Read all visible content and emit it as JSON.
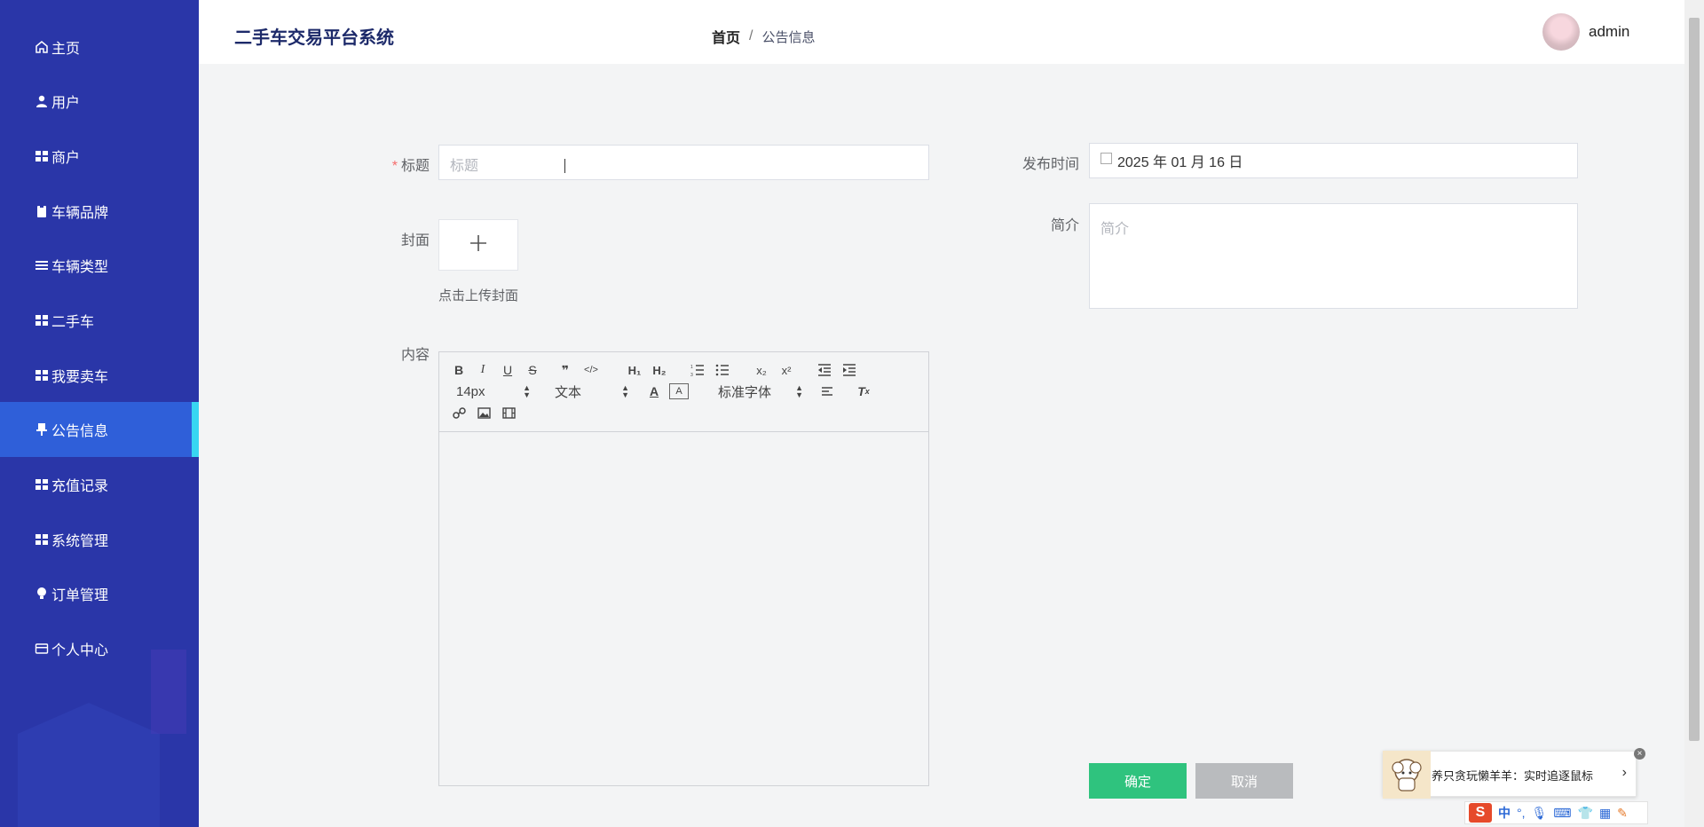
{
  "app": {
    "title": "二手车交易平台系统",
    "user": "admin"
  },
  "breadcrumb": {
    "home": "首页",
    "sep": "/",
    "current": "公告信息"
  },
  "menu": [
    {
      "label": "主页",
      "icon": "home-icon"
    },
    {
      "label": "用户",
      "icon": "user-icon"
    },
    {
      "label": "商户",
      "icon": "grid-icon"
    },
    {
      "label": "车辆品牌",
      "icon": "clipboard-icon"
    },
    {
      "label": "车辆类型",
      "icon": "list-icon"
    },
    {
      "label": "二手车",
      "icon": "grid-icon"
    },
    {
      "label": "我要卖车",
      "icon": "grid-icon"
    },
    {
      "label": "公告信息",
      "icon": "pin-icon",
      "active": true
    },
    {
      "label": "充值记录",
      "icon": "grid-icon"
    },
    {
      "label": "系统管理",
      "icon": "grid-icon"
    },
    {
      "label": "订单管理",
      "icon": "bulb-icon"
    },
    {
      "label": "个人中心",
      "icon": "card-icon"
    }
  ],
  "form": {
    "title_label": "标题",
    "title_placeholder": "标题",
    "date_label": "发布时间",
    "date_value": "2025 年 01 月 16 日",
    "cover_label": "封面",
    "upload_tip": "点击上传封面",
    "intro_label": "简介",
    "intro_placeholder": "简介",
    "content_label": "内容",
    "editor": {
      "font_size": "14px",
      "block": "文本",
      "font_family": "标准字体"
    },
    "submit": "确定",
    "cancel": "取消"
  },
  "ime": {
    "tip": "养只贪玩懒羊羊：实时追逐鼠标",
    "lang": "中",
    "logo": "S"
  },
  "colors": {
    "sidebar": "#2a36a8",
    "active_menu": "#2f5fd9",
    "active_bar": "#38d6f2",
    "primary": "#2fc37e",
    "cancel": "#b9bbbe",
    "title": "#1d2a6a"
  }
}
